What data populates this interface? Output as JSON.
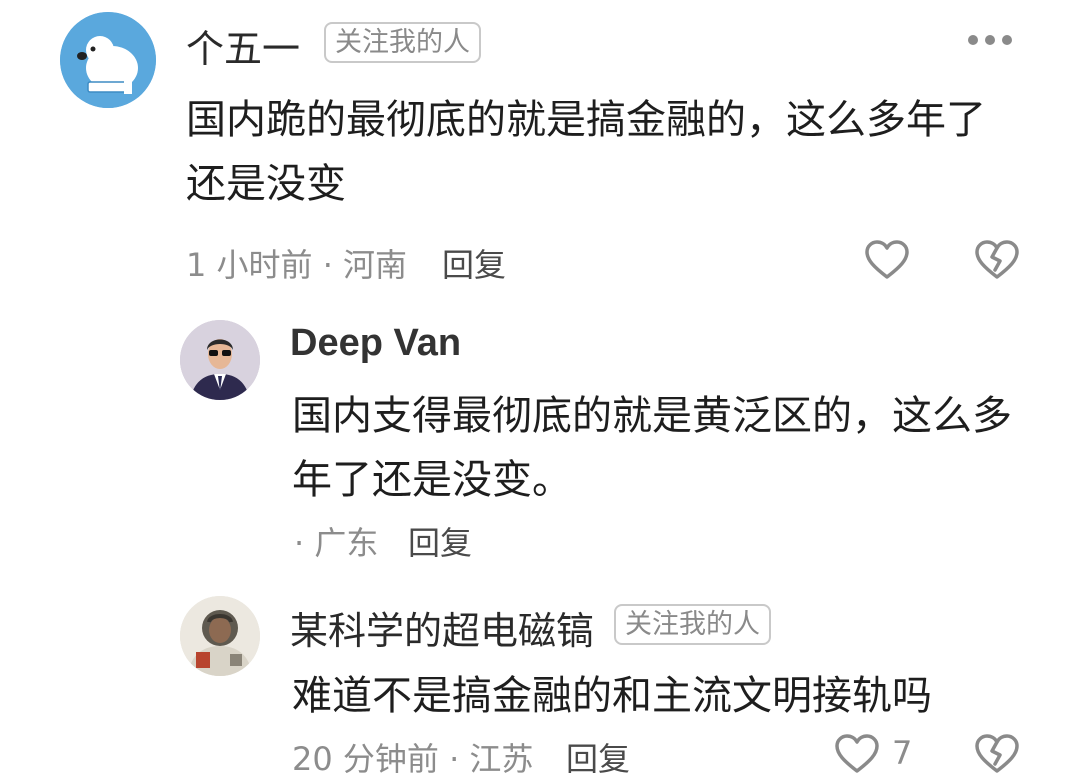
{
  "comments": [
    {
      "user": "个五一",
      "tag": "关注我的人",
      "content": "国内跪的最彻底的就是搞金融的，这么多年了还是没变",
      "time": "1 小时前 · 河南",
      "reply_label": "回复",
      "more_icon": "more-dots-icon"
    },
    {
      "user": "Deep Van",
      "content": "国内支得最彻底的就是黄泛区的，这么多年了还是没变。",
      "time": "· 广东",
      "reply_label": "回复"
    },
    {
      "user": "某科学的超电磁镐",
      "tag": "关注我的人",
      "content": "难道不是搞金融的和主流文明接轨吗",
      "time": "20 分钟前 · 江苏",
      "reply_label": "回复",
      "like_count": "7"
    }
  ],
  "colors": {
    "icon_gray": "#8a8a8a",
    "avatar1_bg": "#5aa8dd"
  }
}
